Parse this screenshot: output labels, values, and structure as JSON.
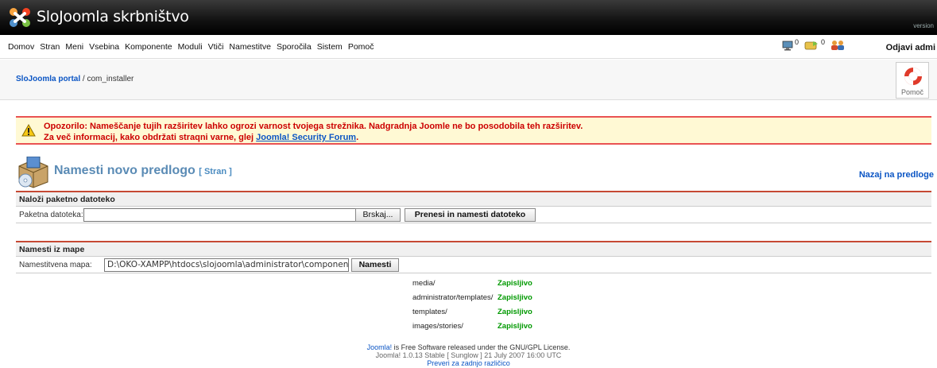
{
  "header": {
    "title": "SloJoomla  skrbništvo",
    "version": "version"
  },
  "menu": {
    "items": [
      "Domov",
      "Stran",
      "Meni",
      "Vsebina",
      "Komponente",
      "Moduli",
      "Vtiči",
      "Namestitve",
      "Sporočila",
      "Sistem",
      "Pomoč"
    ],
    "status_messages": "0",
    "status_users": "0",
    "logout": "Odjavi admi"
  },
  "breadcrumb": {
    "site": "SloJoomla portal",
    "path": " / com_installer"
  },
  "toolbar": {
    "help_label": "Pomoč"
  },
  "warning": {
    "line1": "Opozorilo: Nameščanje tujih razširitev lahko ogrozi varnost tvojega strežnika. Nadgradnja Joomle ne bo posodobila teh razširitev.",
    "line2_prefix": "Za več informacij, kako obdržati straqni varne, glej ",
    "line2_link": "Joomla! Security Forum",
    "line2_suffix": "."
  },
  "page": {
    "title": "Namesti novo predlogo",
    "subtitle": "[ Stran ]",
    "back_link": "Nazaj na predloge"
  },
  "upload": {
    "heading": "Naloži paketno datoteko",
    "label": "Paketna datoteka:",
    "browse": "Brskaj...",
    "submit": "Prenesi in namesti datoteko"
  },
  "install_dir": {
    "heading": "Namesti iz mape",
    "label": "Namestitvena mapa:",
    "value": "D:\\OKO-XAMPP\\htdocs\\slojoomla\\administrator\\components\\com_insta",
    "submit": "Namesti"
  },
  "directories": [
    {
      "name": "media/",
      "status": "Zapisljivo"
    },
    {
      "name": "administrator/templates/",
      "status": "Zapisljivo"
    },
    {
      "name": "templates/",
      "status": "Zapisljivo"
    },
    {
      "name": "images/stories/",
      "status": "Zapisljivo"
    }
  ],
  "footer": {
    "joomla": "Joomla!",
    "line1": " is Free Software released under the GNU/GPL License.",
    "line2": "Joomla! 1.0.13 Stable [ Sunglow ] 21 July 2007 16:00 UTC",
    "line3": "Preveri za zadnjo različico"
  },
  "colors": {
    "accent": "#c64934",
    "link": "#0b55c4",
    "ok": "#009900",
    "warning_bg": "#fff9d4"
  }
}
